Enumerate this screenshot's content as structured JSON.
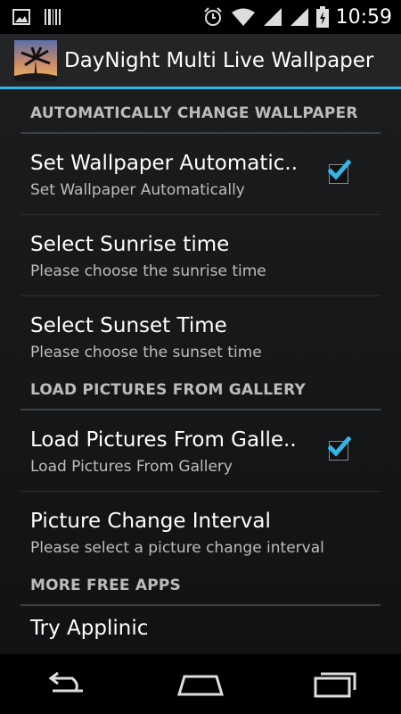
{
  "status_bar": {
    "time": "10:59",
    "icons": [
      "image-icon",
      "barcode-icon",
      "alarm-icon",
      "wifi-icon",
      "signal-icon",
      "signal-icon",
      "battery-icon"
    ]
  },
  "action_bar": {
    "title": "DayNight Multi Live Wallpaper",
    "icon": "palm-sunset-icon"
  },
  "sections": [
    {
      "header": "AUTOMATICALLY CHANGE WALLPAPER",
      "items": [
        {
          "title": "Set Wallpaper Automatic..",
          "summary": "Set Wallpaper Automatically",
          "checked": true
        },
        {
          "title": "Select Sunrise time",
          "summary": "Please choose the sunrise time"
        },
        {
          "title": "Select Sunset Time",
          "summary": "Please choose the sunset time"
        }
      ]
    },
    {
      "header": "LOAD PICTURES FROM GALLERY",
      "items": [
        {
          "title": "Load Pictures From Galle..",
          "summary": "Load Pictures From Gallery",
          "checked": true
        },
        {
          "title": "Picture Change Interval",
          "summary": "Please select a picture change interval"
        }
      ]
    },
    {
      "header": "MORE FREE APPS",
      "items": [
        {
          "title": "Try Applinic",
          "summary": ""
        }
      ]
    }
  ],
  "nav_bar": {
    "icons": [
      "back-icon",
      "home-icon",
      "recent-apps-icon"
    ]
  },
  "colors": {
    "accent": "#33b5e5",
    "background": "#1b1d1f"
  }
}
